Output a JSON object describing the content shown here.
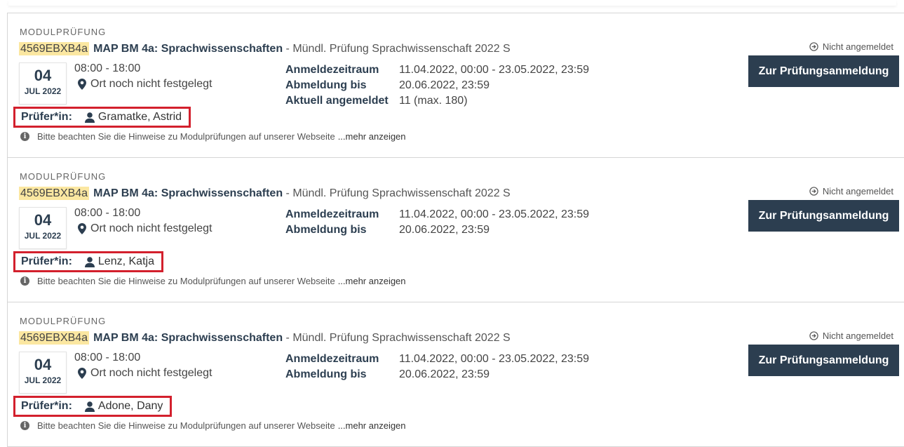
{
  "exams": [
    {
      "kind": "MODULPRÜFUNG",
      "code": "4569EBXB4a",
      "module": "MAP BM 4a: Sprachwissenschaften",
      "subtitle": " - Mündl. Prüfung Sprachwissenschaft 2022 S",
      "day": "04",
      "month_year": "JUL 2022",
      "time": "08:00 - 18:00",
      "location": "Ort noch nicht festgelegt",
      "registration": [
        {
          "label": "Anmeldezeitraum",
          "value": "11.04.2022, 00:00 - 23.05.2022, 23:59"
        },
        {
          "label": "Abmeldung bis",
          "value": "20.06.2022, 23:59"
        },
        {
          "label": "Aktuell angemeldet",
          "value": "11 (max. 180)"
        }
      ],
      "examiner_label": "Prüfer*in:",
      "examiner": "Gramatke, Astrid",
      "hint": "Bitte beachten Sie die Hinweise zu Modulprüfungen auf unserer Webseite",
      "more": "...mehr anzeigen",
      "status": "Nicht angemeldet",
      "button": "Zur Prüfungsanmeldung"
    },
    {
      "kind": "MODULPRÜFUNG",
      "code": "4569EBXB4a",
      "module": "MAP BM 4a: Sprachwissenschaften",
      "subtitle": " - Mündl. Prüfung Sprachwissenschaft 2022 S",
      "day": "04",
      "month_year": "JUL 2022",
      "time": "08:00 - 18:00",
      "location": "Ort noch nicht festgelegt",
      "registration": [
        {
          "label": "Anmeldezeitraum",
          "value": "11.04.2022, 00:00 - 23.05.2022, 23:59"
        },
        {
          "label": "Abmeldung bis",
          "value": "20.06.2022, 23:59"
        }
      ],
      "examiner_label": "Prüfer*in:",
      "examiner": "Lenz, Katja",
      "hint": "Bitte beachten Sie die Hinweise zu Modulprüfungen auf unserer Webseite",
      "more": "...mehr anzeigen",
      "status": "Nicht angemeldet",
      "button": "Zur Prüfungsanmeldung"
    },
    {
      "kind": "MODULPRÜFUNG",
      "code": "4569EBXB4a",
      "module": "MAP BM 4a: Sprachwissenschaften",
      "subtitle": " - Mündl. Prüfung Sprachwissenschaft 2022 S",
      "day": "04",
      "month_year": "JUL 2022",
      "time": "08:00 - 18:00",
      "location": "Ort noch nicht festgelegt",
      "registration": [
        {
          "label": "Anmeldezeitraum",
          "value": "11.04.2022, 00:00 - 23.05.2022, 23:59"
        },
        {
          "label": "Abmeldung bis",
          "value": "20.06.2022, 23:59"
        }
      ],
      "examiner_label": "Prüfer*in:",
      "examiner": "Adone, Dany",
      "hint": "Bitte beachten Sie die Hinweise zu Modulprüfungen auf unserer Webseite",
      "more": "...mehr anzeigen",
      "status": "Nicht angemeldet",
      "button": "Zur Prüfungsanmeldung"
    }
  ],
  "colors": {
    "accent": "#2c3e50",
    "highlight": "#fbe7a1",
    "annotation": "#d3202d"
  },
  "icons": {
    "location": "map-marker-icon",
    "person": "user-icon",
    "info": "info-circle-icon",
    "status": "arrow-circle-right-icon"
  }
}
